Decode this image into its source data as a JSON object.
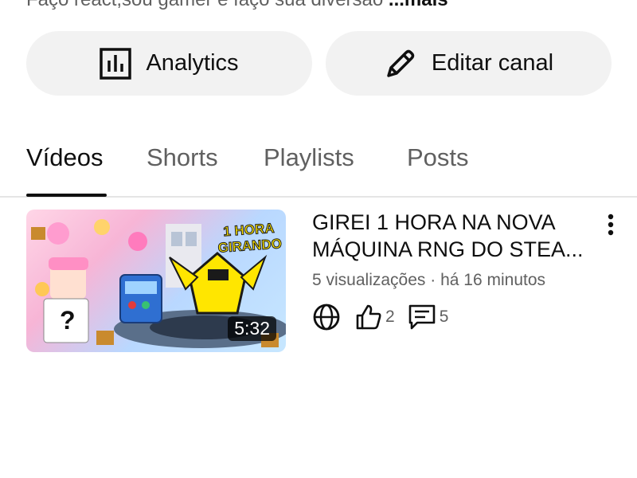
{
  "channel": {
    "description_preview": "Faço react,sou gamer e faço sua diversão",
    "more_label": "...mais"
  },
  "actions": {
    "analytics_label": "Analytics",
    "edit_channel_label": "Editar canal"
  },
  "tabs": [
    {
      "label": "Vídeos",
      "active": true
    },
    {
      "label": "Shorts",
      "active": false
    },
    {
      "label": "Playlists",
      "active": false
    },
    {
      "label": "Posts",
      "active": false
    }
  ],
  "videos": [
    {
      "title_line1": "GIREI 1 HORA NA NOVA",
      "title_line2": "MÁQUINA RNG DO STEA...",
      "views": "5 visualizações",
      "separator": "·",
      "posted": "há 16 minutos",
      "duration": "5:32",
      "thumbnail_text_line1": "1 HORA",
      "thumbnail_text_line2": "GIRANDO",
      "visibility_icon": "globe-icon",
      "likes": "2",
      "comments": "5"
    }
  ],
  "colors": {
    "text_primary": "#0f0f0f",
    "text_secondary": "#606060",
    "button_bg": "#f2f2f2",
    "divider": "#e5e5e5"
  }
}
